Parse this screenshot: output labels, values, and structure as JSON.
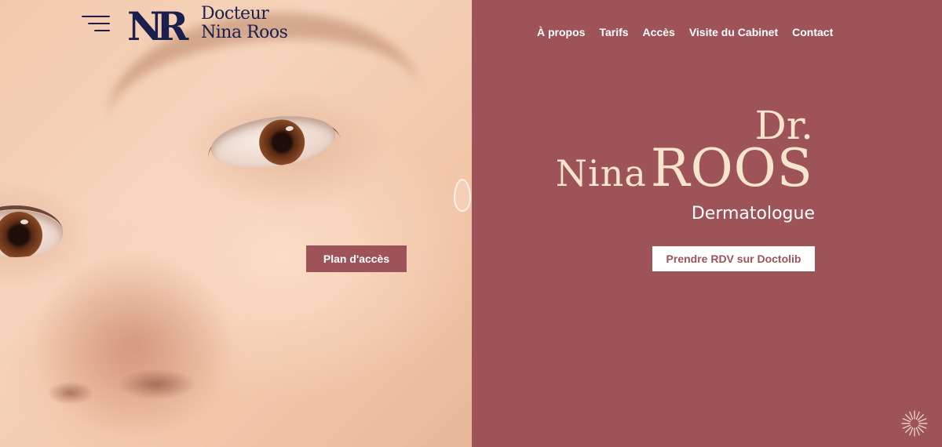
{
  "header": {
    "logo_monogram": "NR",
    "logo_line1": "Docteur",
    "logo_line2": "Nina Roos",
    "menu_icon": "hamburger-menu-icon"
  },
  "nav": {
    "items": [
      "À propos",
      "Tarifs",
      "Accès",
      "Visite du Cabinet",
      "Contact"
    ]
  },
  "hero": {
    "title_prefix": "Dr.",
    "first_name": "Nina",
    "last_name": "ROOS",
    "subtitle": "Dermatologue"
  },
  "buttons": {
    "access_map": "Plan d'accès",
    "book_appointment": "Prendre RDV sur Doctolib"
  },
  "widget": {
    "icon": "starburst-icon"
  },
  "colors": {
    "accent": "#9e5358",
    "logo_navy": "#1a1f4d",
    "hero_text": "#f6e5cc",
    "white": "#ffffff"
  }
}
